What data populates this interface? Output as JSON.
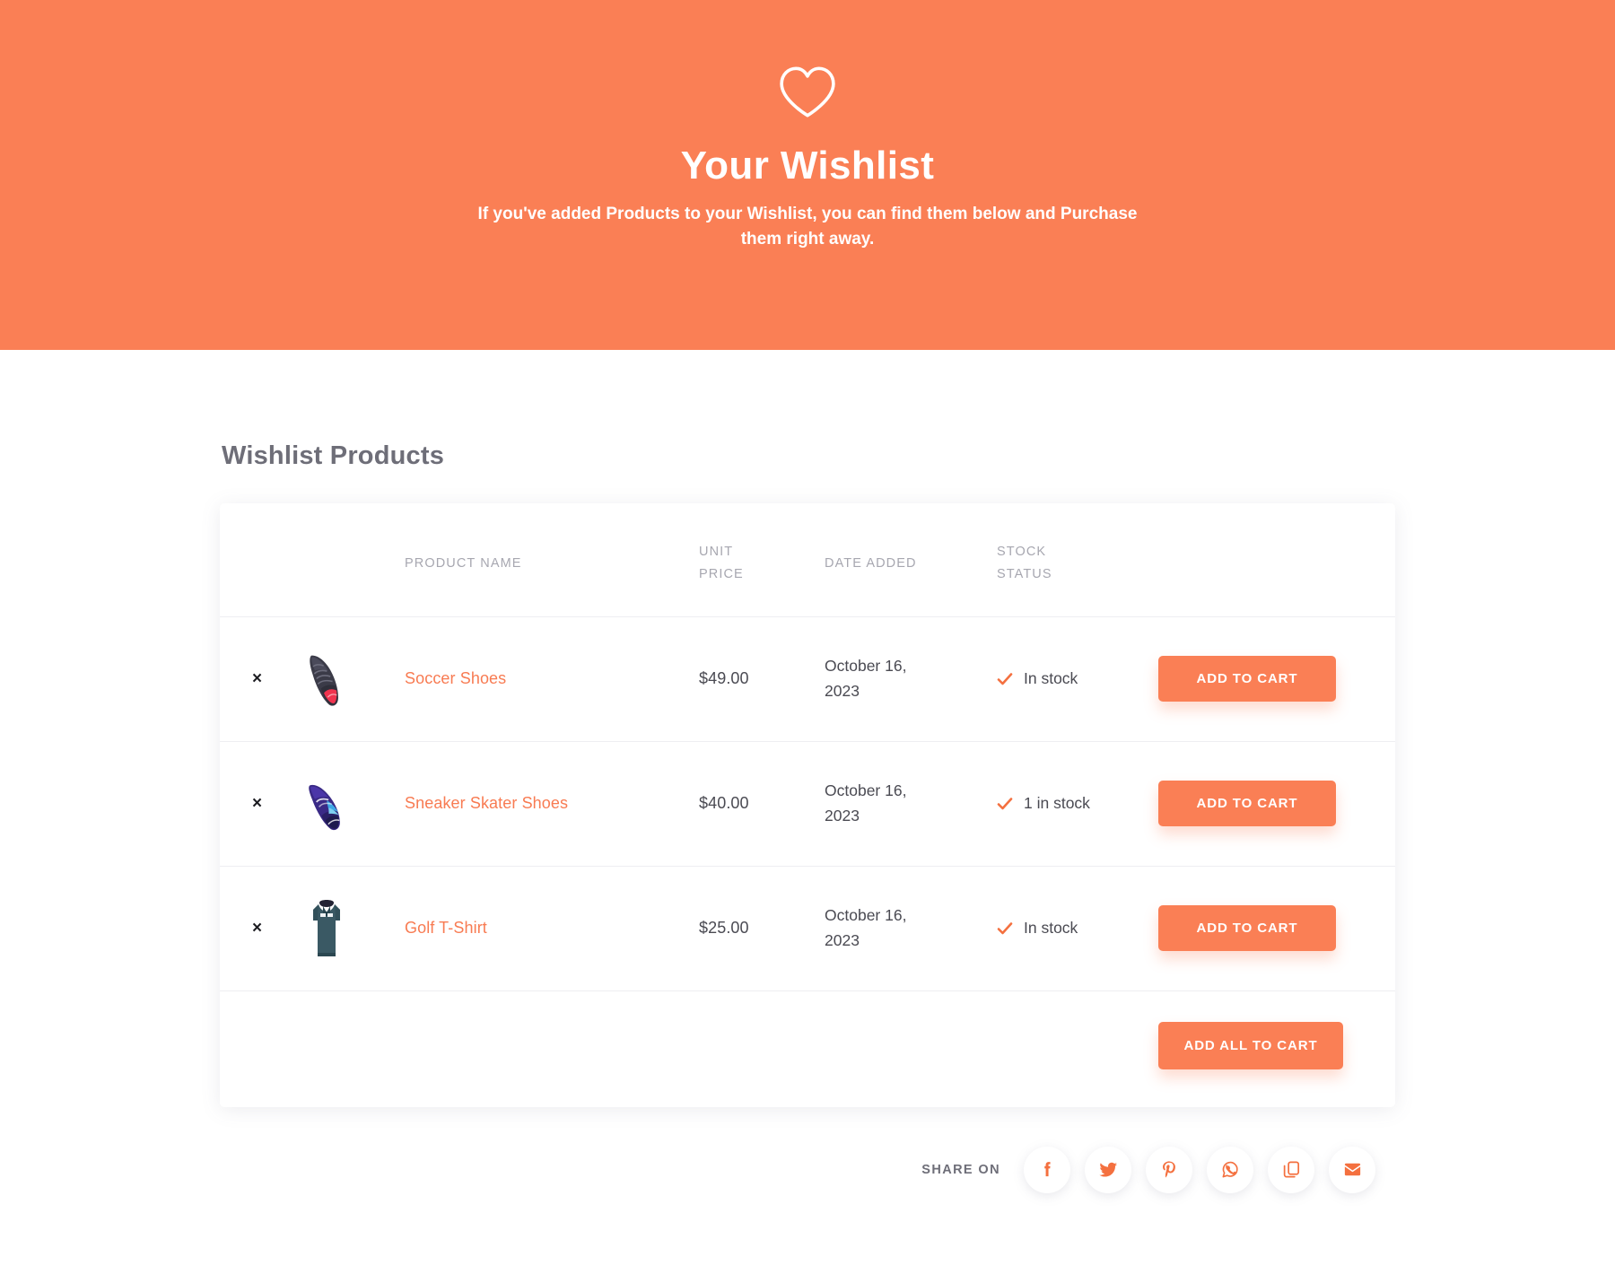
{
  "hero": {
    "icon": "heart-icon",
    "title": "Your Wishlist",
    "subtitle": "If you've added Products to your Wishlist, you can find them below and Purchase them right away."
  },
  "main": {
    "section_title": "Wishlist Products"
  },
  "table": {
    "headers": {
      "remove": "",
      "thumbnail": "",
      "product_name": "PRODUCT NAME",
      "unit_price_line1": "UNIT",
      "unit_price_line2": "PRICE",
      "date_added": "DATE ADDED",
      "stock_status_line1": "STOCK",
      "stock_status_line2": "STATUS",
      "action": ""
    },
    "remove_label": "×",
    "rows": [
      {
        "name": "Soccer Shoes",
        "price": "$49.00",
        "date_added": "October 16, 2023",
        "stock_status": "In stock",
        "button_label": "ADD TO CART",
        "thumb": "soccer-shoe-thumbnail"
      },
      {
        "name": "Sneaker Skater Shoes",
        "price": "$40.00",
        "date_added": "October 16, 2023",
        "stock_status": "1 in stock",
        "button_label": "ADD TO CART",
        "thumb": "sneaker-shoe-thumbnail"
      },
      {
        "name": "Golf T-Shirt",
        "price": "$25.00",
        "date_added": "October 16, 2023",
        "stock_status": "In stock",
        "button_label": "ADD TO CART",
        "thumb": "golf-tshirt-thumbnail"
      }
    ],
    "add_all_label": "ADD ALL TO CART"
  },
  "share": {
    "label": "SHARE ON",
    "items": [
      {
        "name": "facebook-icon"
      },
      {
        "name": "twitter-icon"
      },
      {
        "name": "pinterest-icon"
      },
      {
        "name": "whatsapp-icon"
      },
      {
        "name": "copy-link-icon"
      },
      {
        "name": "email-icon"
      }
    ]
  },
  "colors": {
    "hero_background": "#fa7f55",
    "accent": "#fa7f55",
    "product_link": "#f87b52",
    "heading_text": "#6e6e78",
    "body_text": "#4a4a52",
    "table_header_text": "#a7a7b0"
  }
}
